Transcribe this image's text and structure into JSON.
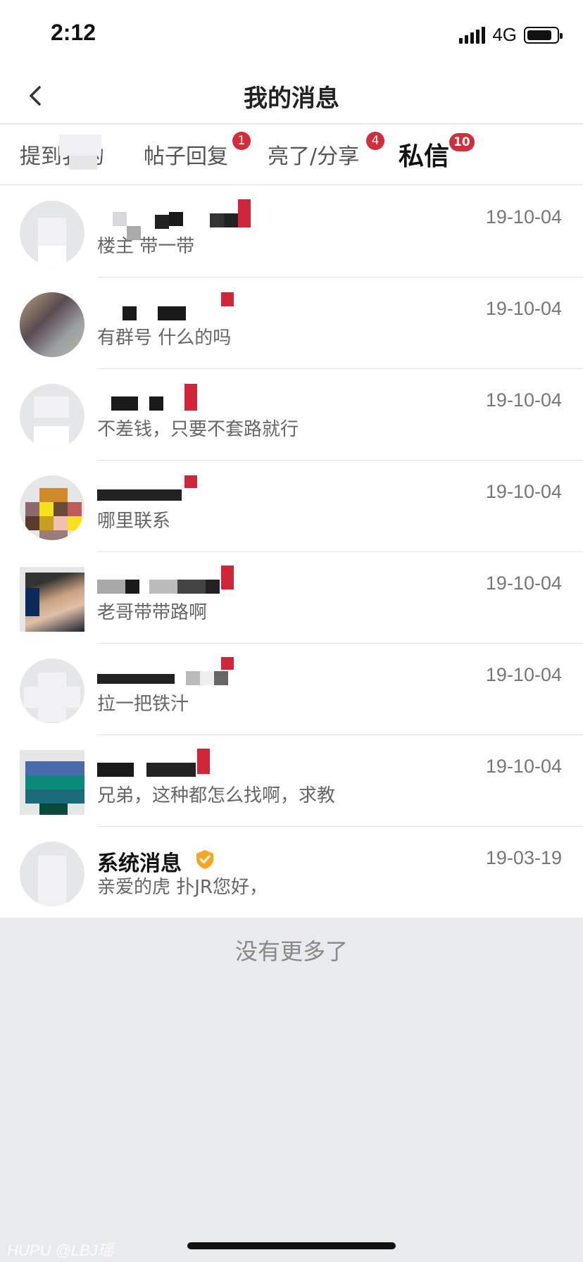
{
  "status_bar": {
    "time": "2:12",
    "network": "4G"
  },
  "nav": {
    "title": "我的消息"
  },
  "tabs": [
    {
      "label": "提到我的",
      "badge": ""
    },
    {
      "label": "帖子回复",
      "badge": "1"
    },
    {
      "label": "亮了/分享",
      "badge": "4"
    },
    {
      "label": "私信",
      "badge": "10"
    }
  ],
  "messages": [
    {
      "name": "",
      "preview": "楼主 带一带",
      "date": "19-10-04"
    },
    {
      "name": "",
      "preview": "有群号 什么的吗",
      "date": "19-10-04"
    },
    {
      "name": "",
      "preview": "不差钱，只要不套路就行",
      "date": "19-10-04"
    },
    {
      "name": "",
      "preview": "哪里联系",
      "date": "19-10-04"
    },
    {
      "name": "",
      "preview": "老哥带带路啊",
      "date": "19-10-04"
    },
    {
      "name": "",
      "preview": "拉一把铁汁",
      "date": "19-10-04"
    },
    {
      "name": "",
      "preview": "兄弟，这种都怎么找啊，求教",
      "date": "19-10-04"
    },
    {
      "name": "系统消息",
      "preview": "亲爱的虎 扑JR您好，",
      "date": "19-03-19"
    }
  ],
  "footer": {
    "empty_text": "没有更多了"
  },
  "watermark": "HUPU @LBJ瑶",
  "colors": {
    "badge": "#d12d3a",
    "verified": "#f5a623",
    "background": "#e9eaec"
  }
}
